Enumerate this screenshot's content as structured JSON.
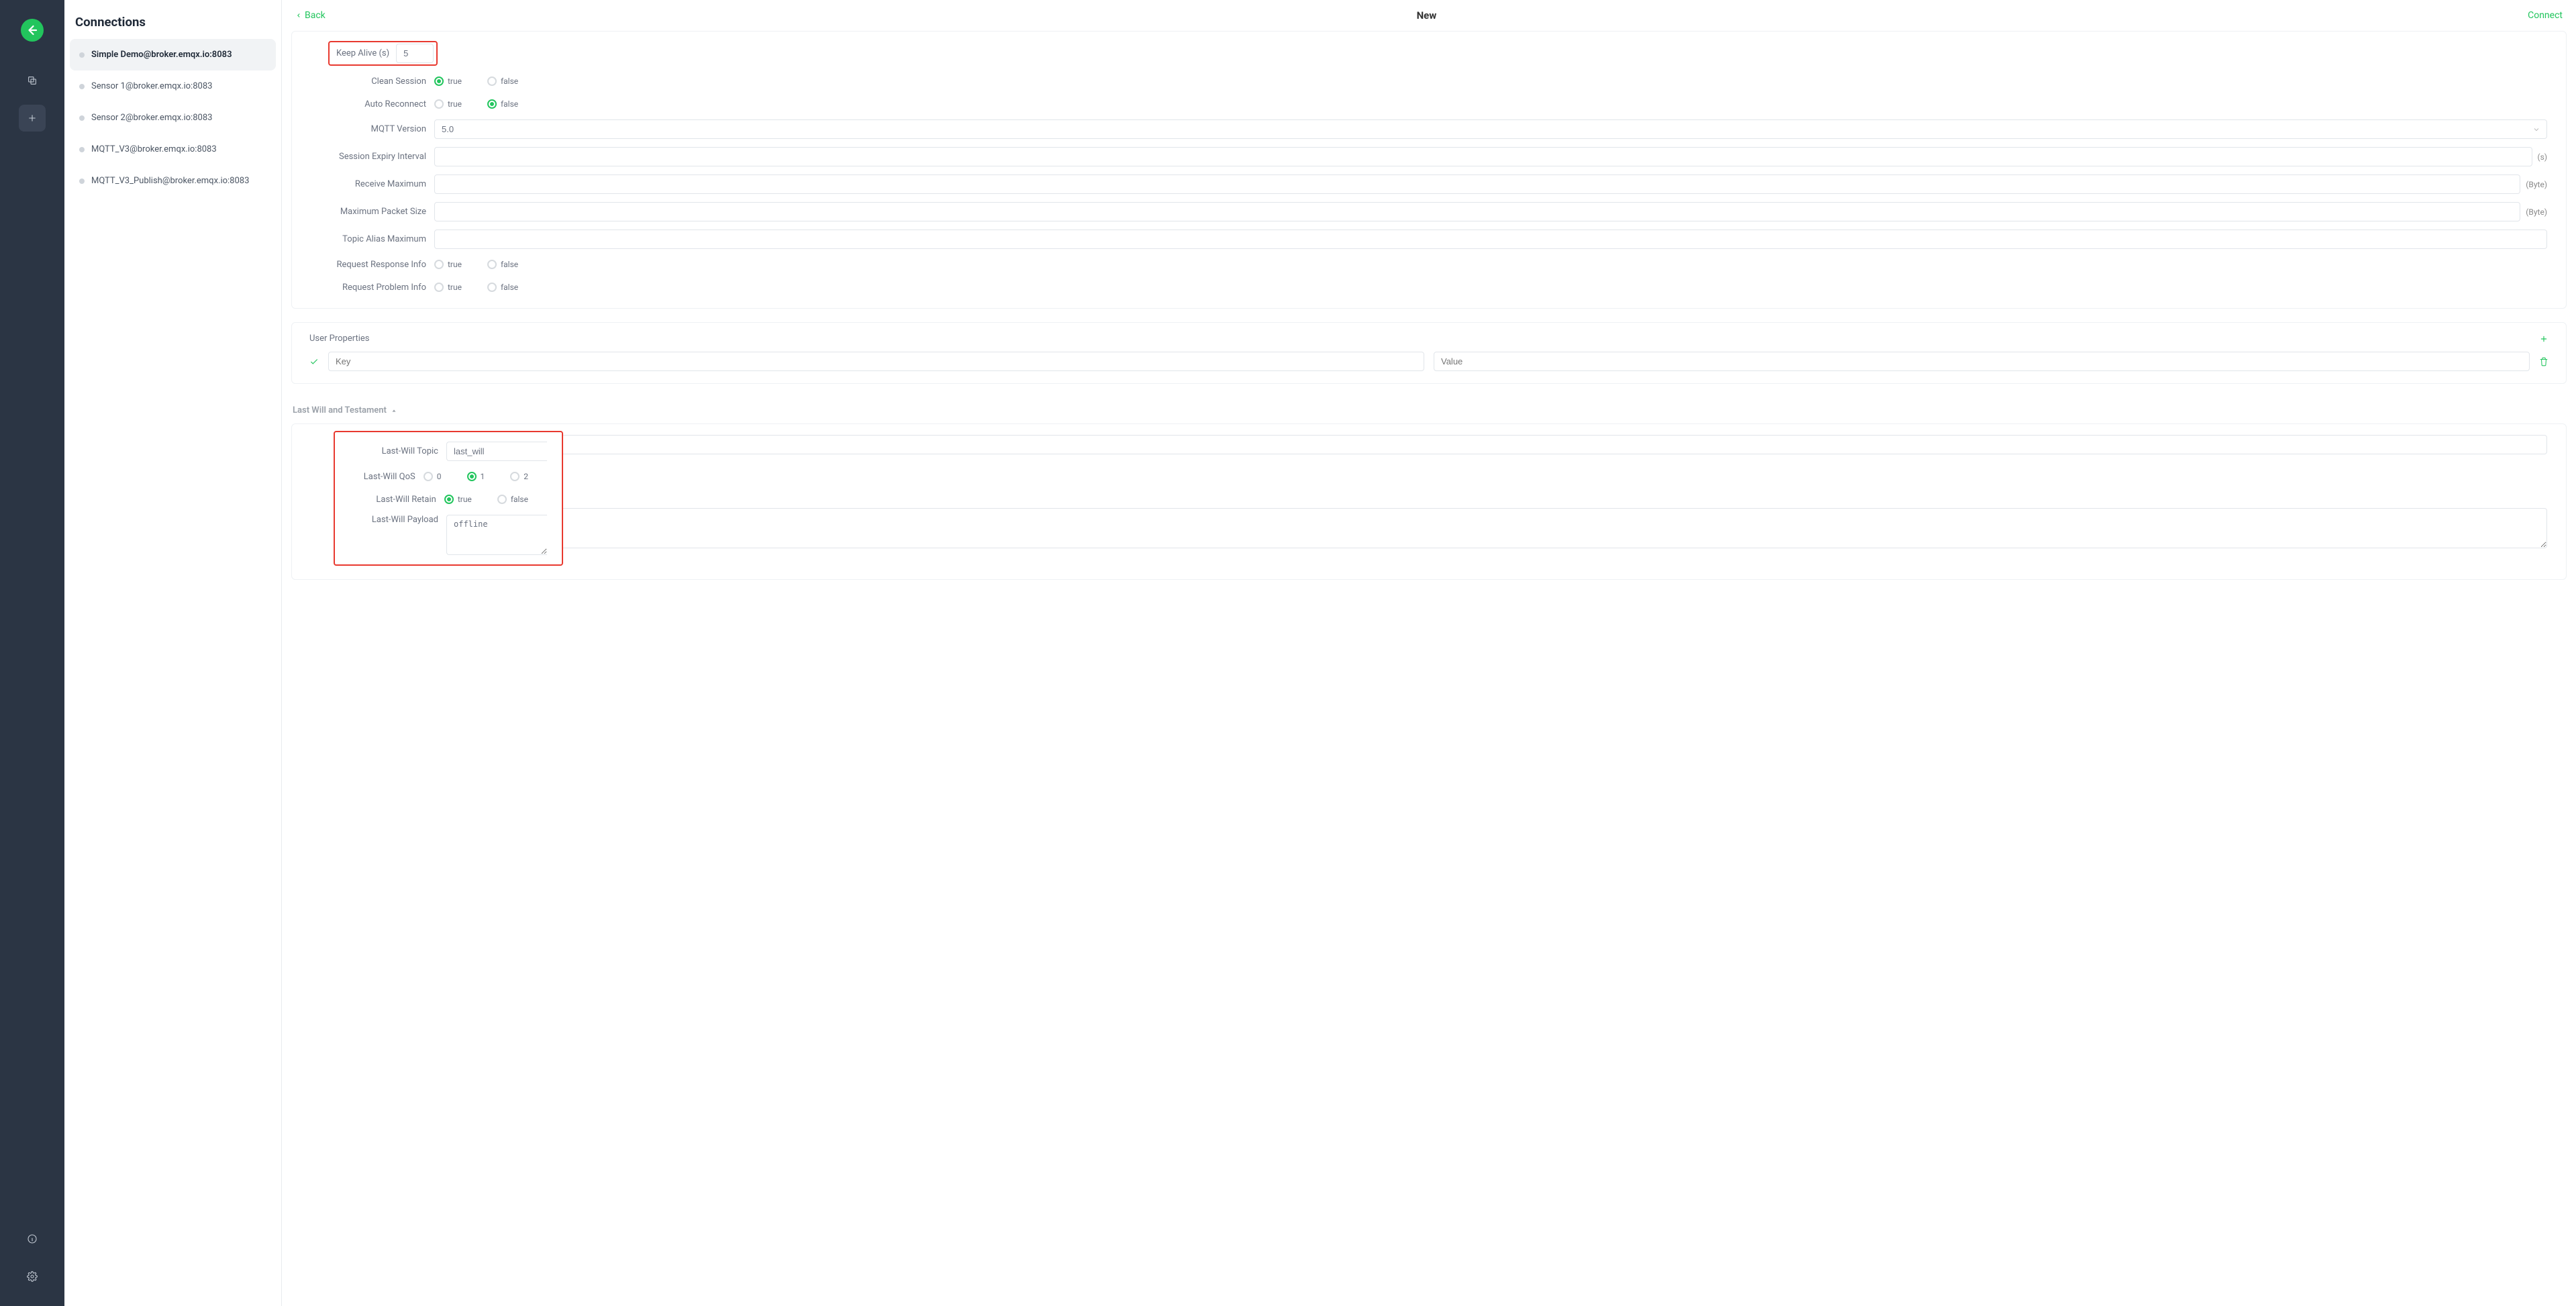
{
  "rail": {
    "logo_glyph": "logo"
  },
  "sidebar": {
    "title": "Connections",
    "items": [
      {
        "label": "Simple Demo@broker.emqx.io:8083",
        "selected": true
      },
      {
        "label": "Sensor 1@broker.emqx.io:8083",
        "selected": false
      },
      {
        "label": "Sensor 2@broker.emqx.io:8083",
        "selected": false
      },
      {
        "label": "MQTT_V3@broker.emqx.io:8083",
        "selected": false
      },
      {
        "label": "MQTT_V3_Publish@broker.emqx.io:8083",
        "selected": false
      }
    ]
  },
  "topbar": {
    "back": "Back",
    "title": "New",
    "connect": "Connect"
  },
  "form": {
    "keep_alive": {
      "label": "Keep Alive (s)",
      "value": "5"
    },
    "clean_session": {
      "label": "Clean Session",
      "true": "true",
      "false": "false",
      "value": "true"
    },
    "auto_reconnect": {
      "label": "Auto Reconnect",
      "true": "true",
      "false": "false",
      "value": "false"
    },
    "mqtt_version": {
      "label": "MQTT Version",
      "value": "5.0"
    },
    "session_expiry": {
      "label": "Session Expiry Interval",
      "value": "",
      "suffix": "(s)"
    },
    "receive_max": {
      "label": "Receive Maximum",
      "value": "",
      "suffix": "(Byte)"
    },
    "max_packet": {
      "label": "Maximum Packet Size",
      "value": "",
      "suffix": "(Byte)"
    },
    "topic_alias_max": {
      "label": "Topic Alias Maximum",
      "value": ""
    },
    "req_resp_info": {
      "label": "Request Response Info",
      "true": "true",
      "false": "false",
      "value": null
    },
    "req_problem_info": {
      "label": "Request Problem Info",
      "true": "true",
      "false": "false",
      "value": null
    }
  },
  "user_props": {
    "title": "User Properties",
    "key_placeholder": "Key",
    "value_placeholder": "Value"
  },
  "lwt": {
    "toggle": "Last Will and Testament",
    "topic": {
      "label": "Last-Will Topic",
      "value": "last_will"
    },
    "qos": {
      "label": "Last-Will QoS",
      "opt0": "0",
      "opt1": "1",
      "opt2": "2",
      "value": "1"
    },
    "retain": {
      "label": "Last-Will Retain",
      "true": "true",
      "false": "false",
      "value": "true"
    },
    "payload": {
      "label": "Last-Will Payload",
      "value": "offline"
    }
  }
}
